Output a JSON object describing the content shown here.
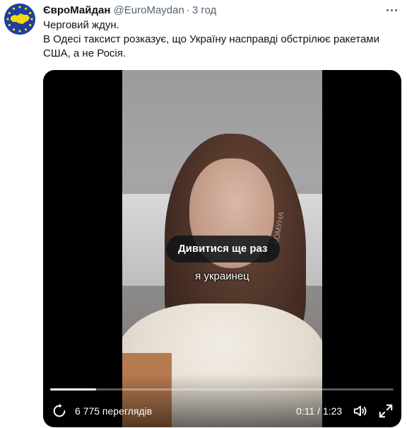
{
  "tweet": {
    "display_name": "ЄвроМайдан",
    "handle": "@EuroMaydan",
    "separator": "·",
    "time": "3 год",
    "text_lines": [
      "Черговий ждун.",
      "В Одесі таксист розказує, що Україну насправді обстрілює ракетами",
      "США, а не Росія."
    ]
  },
  "video": {
    "replay_label": "Дивитися ще раз",
    "subtitle": "я украинец",
    "watermark": "КОМУНА",
    "views": "6 775 переглядів",
    "current_time": "0:11",
    "time_separator": "/",
    "duration": "1:23",
    "progress_fraction": 0.133
  },
  "icons": {
    "more": "more-horizontal-icon",
    "replay": "replay-icon",
    "volume": "volume-icon",
    "fullscreen": "fullscreen-icon"
  },
  "colors": {
    "accent_text": "#0f1419",
    "secondary_text": "#536471",
    "avatar_bg": "#1e3fa0",
    "avatar_map": "#f5d90a"
  }
}
